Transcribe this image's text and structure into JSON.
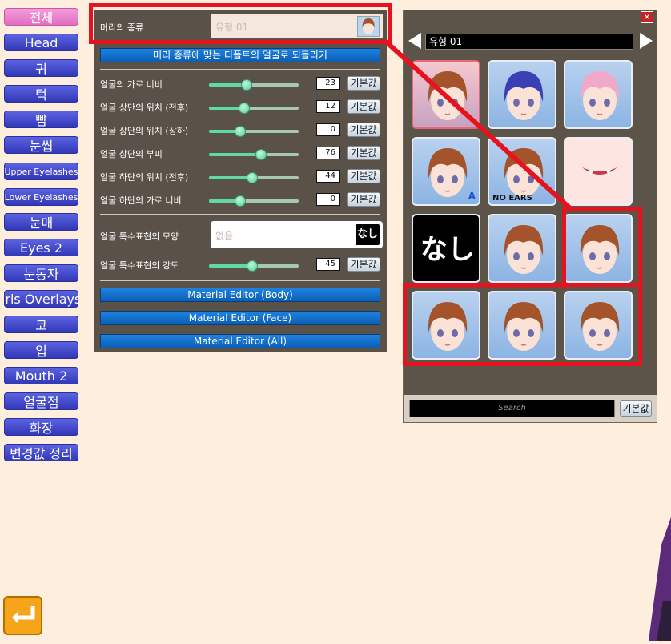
{
  "nav": {
    "items": [
      {
        "label": "전체",
        "active": true
      },
      {
        "label": "Head"
      },
      {
        "label": "귀"
      },
      {
        "label": "턱"
      },
      {
        "label": "뺨"
      },
      {
        "label": "눈썹"
      },
      {
        "label": "Upper Eyelashes",
        "small": true
      },
      {
        "label": "Lower Eyelashes",
        "small": true
      },
      {
        "label": "눈매"
      },
      {
        "label": "Eyes 2"
      },
      {
        "label": "눈동자"
      },
      {
        "label": "Iris Overlays"
      },
      {
        "label": "코"
      },
      {
        "label": "입"
      },
      {
        "label": "Mouth 2"
      },
      {
        "label": "얼굴점"
      },
      {
        "label": "화장"
      },
      {
        "label": "변경값 정리"
      }
    ]
  },
  "panel": {
    "head_type_label": "머리의 종류",
    "head_type_value": "유형 01",
    "reset_face_button": "머리 종류에 맞는 디폴트의 얼굴로 되돌리기",
    "default_label": "기본값",
    "sliders": [
      {
        "label": "얼굴의 가로 너비",
        "value": "23",
        "level": 0.42
      },
      {
        "label": "얼굴 상단의 위치 (전후)",
        "value": "12",
        "level": 0.39
      },
      {
        "label": "얼굴 상단의 위치 (상하)",
        "value": "0",
        "level": 0.35
      },
      {
        "label": "얼굴 상단의 부피",
        "value": "76",
        "level": 0.58
      },
      {
        "label": "얼굴 하단의 위치 (전후)",
        "value": "44",
        "level": 0.48
      },
      {
        "label": "얼굴 하단의 가로 너비",
        "value": "0",
        "level": 0.35
      }
    ],
    "special_shape_label": "얼굴 특수표현의 모양",
    "special_shape_value": "없음",
    "special_shape_thumb": "なし",
    "special_strength": {
      "label": "얼굴 특수표현의 강도",
      "value": "45",
      "level": 0.48
    },
    "material_buttons": [
      "Material Editor (Body)",
      "Material Editor (Face)",
      "Material Editor (All)"
    ]
  },
  "selector": {
    "current": "유형 01",
    "close": "✕",
    "tiles": [
      {
        "kind": "face",
        "hair": "#a4532a",
        "selected": true
      },
      {
        "kind": "face",
        "hair": "#3b3fb4"
      },
      {
        "kind": "face",
        "hair": "#f0a9cb"
      },
      {
        "kind": "face",
        "hair": "#a4532a",
        "badge": "A"
      },
      {
        "kind": "face",
        "hair": "#a4532a",
        "tag": "NO EARS"
      },
      {
        "kind": "mouth"
      },
      {
        "kind": "nashi",
        "text": "なし"
      },
      {
        "kind": "face",
        "hair": "#a4532a"
      },
      {
        "kind": "face",
        "hair": "#a4532a"
      },
      {
        "kind": "face",
        "hair": "#a4532a"
      },
      {
        "kind": "face",
        "hair": "#a4532a"
      },
      {
        "kind": "face",
        "hair": "#a4532a"
      }
    ],
    "search_placeholder": "Search",
    "default_label": "기본값"
  },
  "colors": {
    "highlight": "#e6131f",
    "nav_active": "#e16fc3",
    "nav": "#3a40c4",
    "slider": "#61d9a7"
  }
}
